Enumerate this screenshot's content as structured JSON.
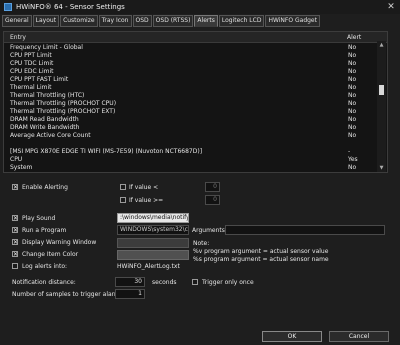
{
  "window": {
    "title": "HWiNFO® 64 - Sensor Settings",
    "close": "✕"
  },
  "tabs": [
    "General",
    "Layout",
    "Customize",
    "Tray Icon",
    "OSD",
    "OSD (RTSS)",
    "Alerts",
    "Logitech LCD",
    "HWiNFO Gadget"
  ],
  "active_tab": "Alerts",
  "list": {
    "col_entry": "Entry",
    "col_alert": "Alert",
    "rows": [
      {
        "name": "Frequency Limit - Global",
        "alert": "No"
      },
      {
        "name": "CPU PPT Limit",
        "alert": "No"
      },
      {
        "name": "CPU TDC Limit",
        "alert": "No"
      },
      {
        "name": "CPU EDC Limit",
        "alert": "No"
      },
      {
        "name": "CPU PPT FAST Limit",
        "alert": "No"
      },
      {
        "name": "Thermal Limit",
        "alert": "No"
      },
      {
        "name": "Thermal Throttling (HTC)",
        "alert": "No"
      },
      {
        "name": "Thermal Throttling (PROCHOT CPU)",
        "alert": "No"
      },
      {
        "name": "Thermal Throttling (PROCHOT EXT)",
        "alert": "No"
      },
      {
        "name": "DRAM Read Bandwidth",
        "alert": "No"
      },
      {
        "name": "DRAM Write Bandwidth",
        "alert": "No"
      },
      {
        "name": "Average Active Core Count",
        "alert": "No"
      },
      {
        "name": "",
        "alert": ""
      },
      {
        "name": "[MSI MPG X870E EDGE TI WIFI (MS-7E59) (Nuvoton NCT6687D)]",
        "alert": "-"
      },
      {
        "name": "CPU",
        "alert": "Yes"
      },
      {
        "name": "System",
        "alert": "No"
      }
    ]
  },
  "alerting": {
    "enable_label": "Enable Alerting",
    "enable_checked": true,
    "if_value_lt": "If value  <",
    "lt_value": "0",
    "if_value_ge": "If value >=",
    "ge_value": "0"
  },
  "actions": {
    "play_sound": "Play Sound",
    "play_sound_checked": true,
    "sound_path": ":\\windows\\media\\notify.wa",
    "run_program": "Run a Program",
    "run_program_checked": true,
    "program_path": "WINDOWS\\system32\\cmd.",
    "arguments_label": "Arguments:",
    "display_warning": "Display Warning Window",
    "display_warning_checked": true,
    "change_color": "Change Item Color",
    "change_color_checked": true,
    "log_alerts": "Log alerts into:",
    "log_alerts_checked": false,
    "log_file": "HWiNFO_AlertLog.txt",
    "note_title": "Note:",
    "note_line1": "%v program argument = actual sensor value",
    "note_line2": "%s program argument = actual sensor name"
  },
  "notification": {
    "distance_label": "Notification distance:",
    "distance_value": "30",
    "distance_unit": "seconds",
    "trigger_once": "Trigger only once",
    "trigger_once_checked": false,
    "samples_label": "Number of samples to trigger alarm:",
    "samples_value": "1"
  },
  "buttons": {
    "ok": "OK",
    "cancel": "Cancel"
  },
  "check_glyph": "✕"
}
